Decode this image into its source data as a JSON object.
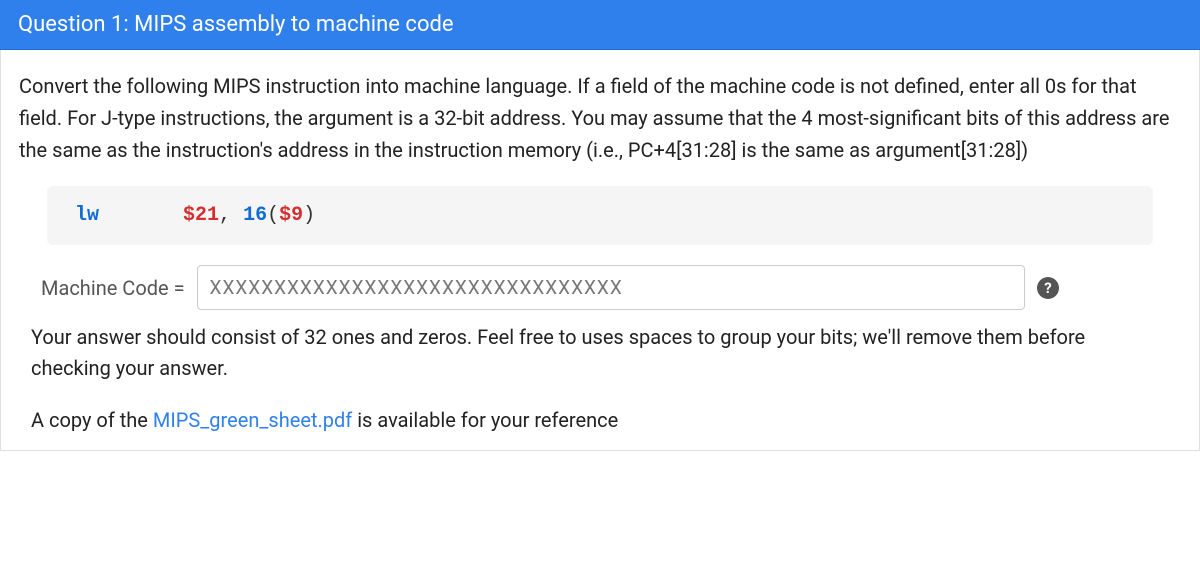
{
  "header": {
    "title": "Question 1: MIPS assembly to machine code"
  },
  "body": {
    "instructions": "Convert the following MIPS instruction into machine language. If a field of the machine code is not defined, enter all 0s for that field. For J-type instructions, the argument is a 32-bit address. You may assume that the 4 most-significant bits of this address are the same as the instruction's address in the instruction memory (i.e., PC+4[31:28] is the same as argument[31:28])",
    "code": {
      "op": "lw",
      "spacing": "       ",
      "rt": "$21",
      "comma": ", ",
      "offset": "16",
      "lparen": "(",
      "rs": "$9",
      "rparen": ")"
    },
    "answer": {
      "label": "Machine Code =",
      "placeholder": "XXXXXXXXXXXXXXXXXXXXXXXXXXXXXXXX",
      "help_symbol": "?"
    },
    "hint": "Your answer should consist of 32 ones and zeros. Feel free to uses spaces to group your bits; we'll remove them before checking your answer.",
    "reference_prefix": "A copy of the ",
    "reference_link": "MIPS_green_sheet.pdf",
    "reference_suffix": " is available for your reference"
  }
}
